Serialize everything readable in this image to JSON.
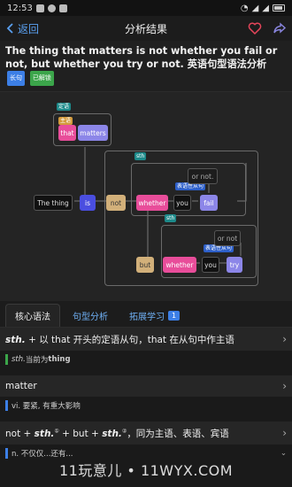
{
  "status_bar": {
    "time": "12:53"
  },
  "nav": {
    "back_label": "返回",
    "title": "分析结果"
  },
  "sentence": {
    "text": "The thing that matters is not whether you fail or not, but whether you try or not. 英语句型语法分析",
    "tag_long": "长句",
    "tag_unlocked": "已解锁"
  },
  "diagram": {
    "label_dingyu": "定语",
    "label_zhuyu": "主语",
    "label_sth1": "sth",
    "label_sth2": "sth",
    "label_biaoyu1": "表语性从句",
    "label_biaoyu2": "表语性从句",
    "node_that": "that",
    "node_matters": "matters",
    "node_the_thing": "The thing",
    "node_is": "is",
    "node_not": "not",
    "node_whether1": "whether",
    "node_you1": "you",
    "node_fail": "fail",
    "node_or_not1": "or not.",
    "node_but": "but",
    "node_whether2": "whether",
    "node_you2": "you",
    "node_try": "try",
    "node_or_not2": "or not"
  },
  "tabs": [
    {
      "label": "核心语法"
    },
    {
      "label": "句型分析"
    },
    {
      "label": "拓展学习",
      "count": "1"
    }
  ],
  "rules": [
    {
      "title_a": "sth.",
      "title_b": " + 以 that 开头的定语从句，that 在从句中作主语",
      "sub_a": "sth.",
      "sub_b": "  当前为 ",
      "sub_c": "thing"
    },
    {
      "title": "matter",
      "sub": "vi. 要紧, 有重大影响"
    },
    {
      "title_a": "not + ",
      "title_b": "sth.",
      "sup1": "①",
      "title_c": " + but + ",
      "title_d": "sth.",
      "sup2": "②",
      "title_e": "，同为主语、表语、宾语",
      "sub": "n. 不仅仅...还有..."
    }
  ],
  "watermark": "11玩意儿 • 11WYX.COM"
}
